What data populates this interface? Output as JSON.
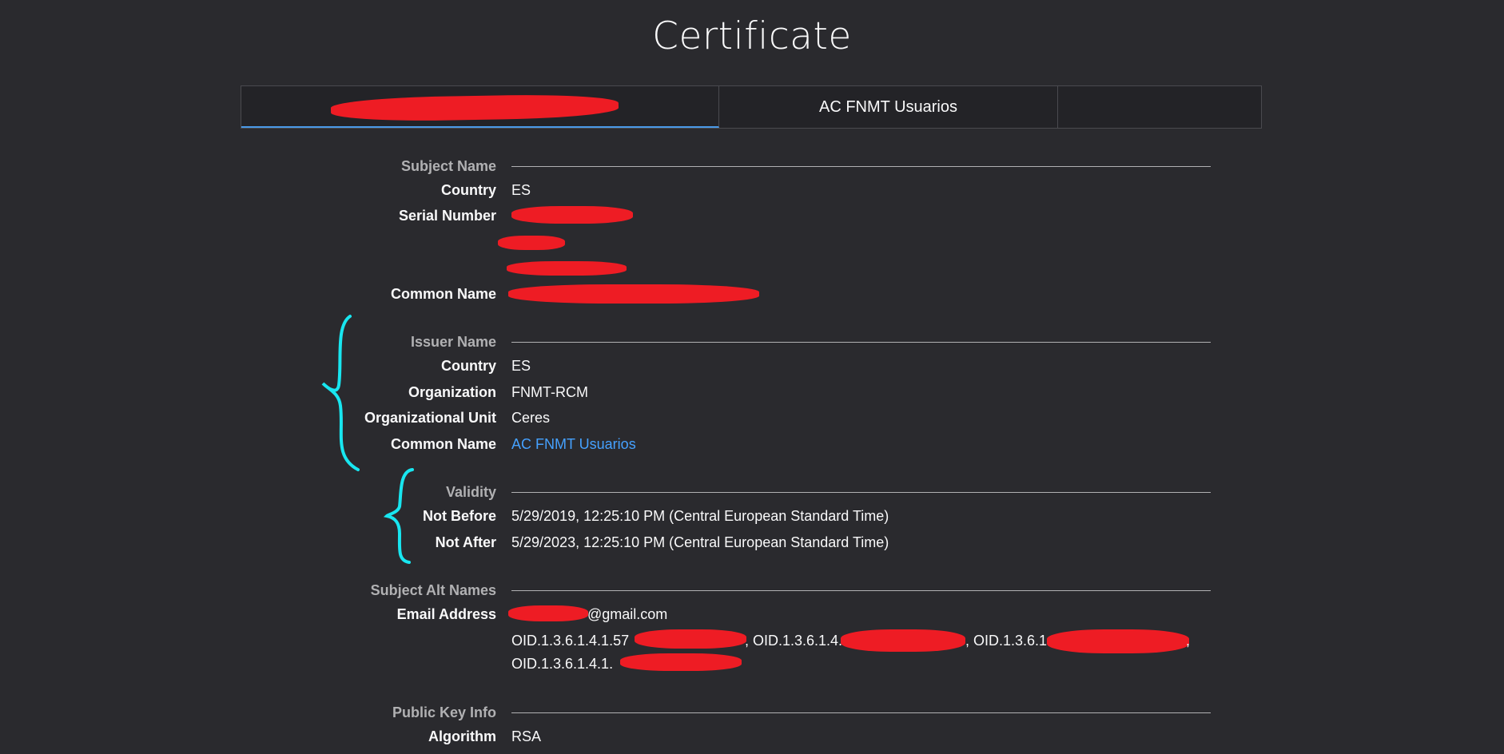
{
  "header": {
    "title": "Certificate"
  },
  "tabs": [
    {
      "label": ""
    },
    {
      "label": "AC FNMT Usuarios"
    },
    {
      "label": ""
    }
  ],
  "subject": {
    "section_title": "Subject Name",
    "country_label": "Country",
    "country_value": "ES",
    "serial_label": "Serial Number",
    "common_name_label": "Common Name"
  },
  "issuer": {
    "section_title": "Issuer Name",
    "country_label": "Country",
    "country_value": "ES",
    "org_label": "Organization",
    "org_value": "FNMT-RCM",
    "ou_label": "Organizational Unit",
    "ou_value": "Ceres",
    "cn_label": "Common Name",
    "cn_value": "AC FNMT Usuarios"
  },
  "validity": {
    "section_title": "Validity",
    "not_before_label": "Not Before",
    "not_before_value": "5/29/2019, 12:25:10 PM (Central European Standard Time)",
    "not_after_label": "Not After",
    "not_after_value": "5/29/2023, 12:25:10 PM (Central European Standard Time)"
  },
  "alt_names": {
    "section_title": "Subject Alt Names",
    "email_label": "Email Address",
    "email_value": "@gmail.com",
    "oid_1": "OID.1.3.6.1.4.1.57",
    "oid_2": ", OID.1.3.6.1.4.1",
    "oid_3": ", OID.1.3.6.1.4",
    "oid_3_end": ",",
    "oid_4": "OID.1.3.6.1.4.1."
  },
  "public_key": {
    "section_title": "Public Key Info",
    "algorithm_label": "Algorithm",
    "algorithm_value": "RSA"
  },
  "colors": {
    "background": "#2a2a2e",
    "link": "#45a1ff",
    "tab_active_underline": "#4a9ae8",
    "redaction": "#ee1c24",
    "annotation_brace": "#18e6f0"
  }
}
